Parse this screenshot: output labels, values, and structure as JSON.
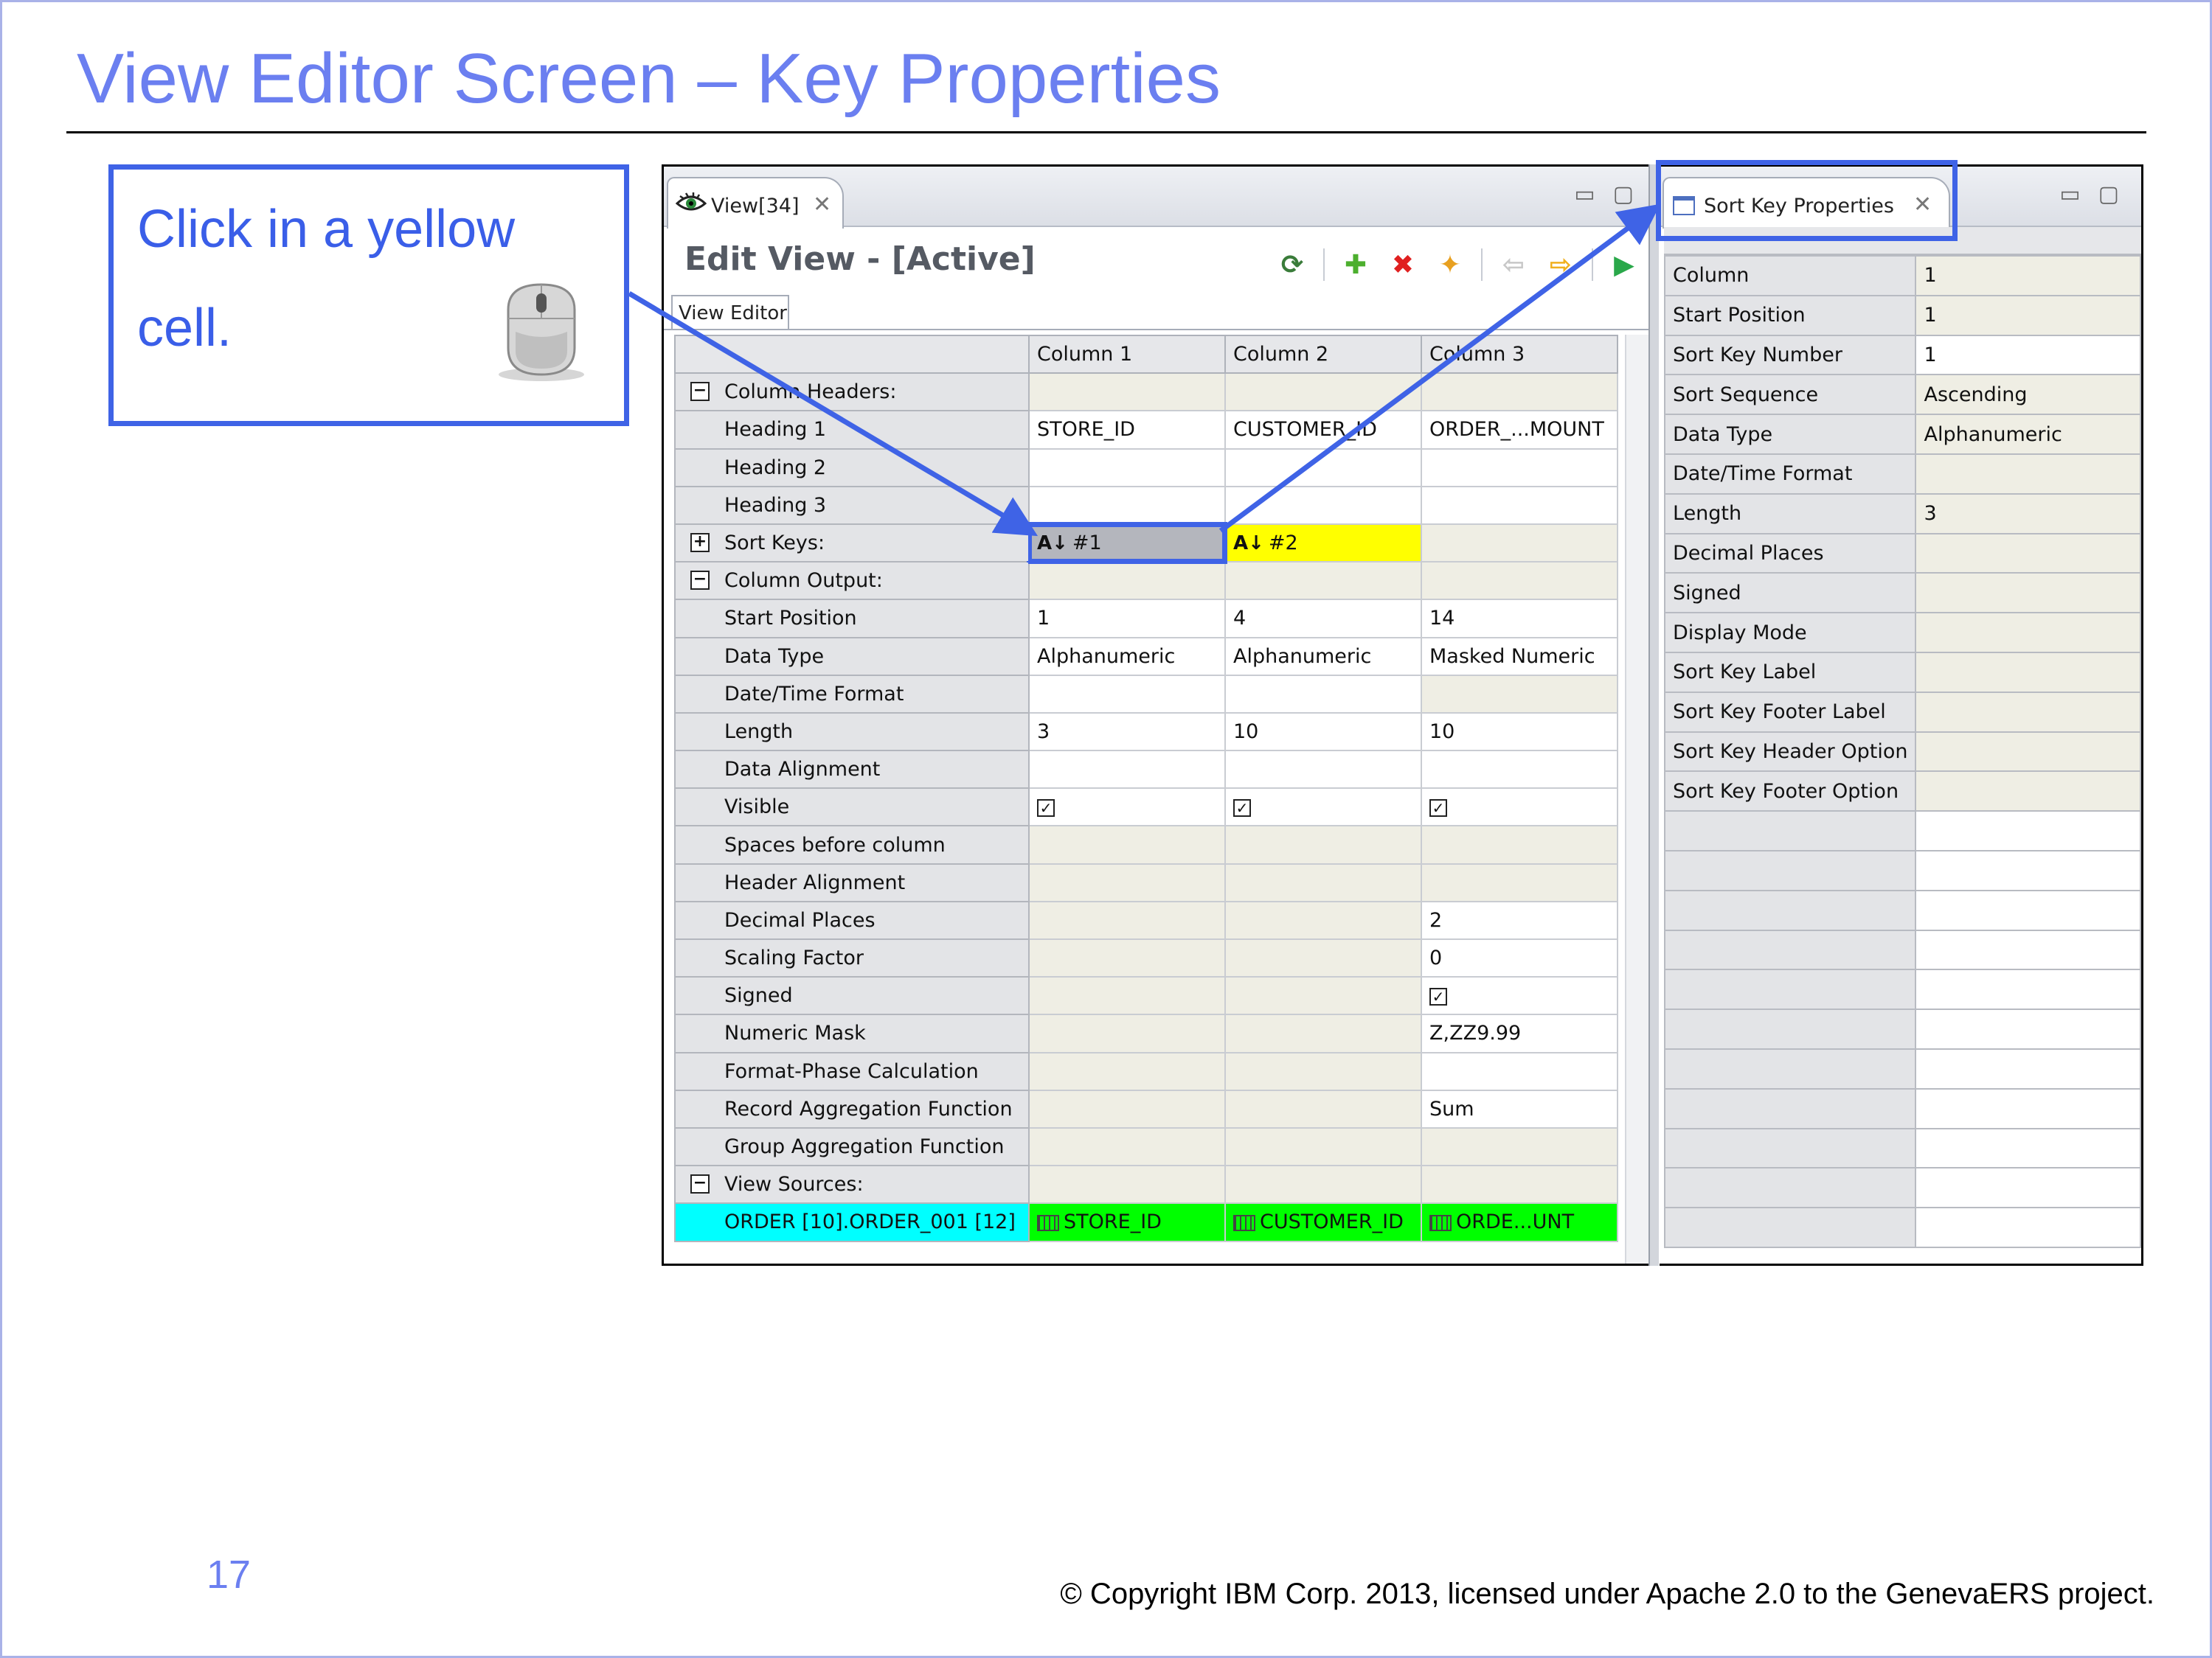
{
  "slide": {
    "title": "View Editor Screen – Key Properties",
    "callout_text": "Click in a yellow cell.",
    "slide_number": "17",
    "copyright": "© Copyright IBM Corp. 2013, licensed under Apache 2.0 to the GenevaERS project."
  },
  "editor": {
    "tab_label": "View[34]",
    "heading": "Edit View - [Active]",
    "subtab": "View Editor",
    "columns": [
      "Column 1",
      "Column 2",
      "Column 3"
    ],
    "rows": {
      "column_headers": "Column Headers:",
      "heading1": {
        "label": "Heading 1",
        "c1": "STORE_ID",
        "c2": "CUSTOMER_ID",
        "c3": "ORDER_...MOUNT"
      },
      "heading2": {
        "label": "Heading 2"
      },
      "heading3": {
        "label": "Heading 3"
      },
      "sort_keys": {
        "label": "Sort Keys:",
        "c1": "#1",
        "c2": "#2"
      },
      "column_output": "Column Output:",
      "start_position": {
        "label": "Start Position",
        "c1": "1",
        "c2": "4",
        "c3": "14"
      },
      "data_type": {
        "label": "Data Type",
        "c1": "Alphanumeric",
        "c2": "Alphanumeric",
        "c3": "Masked Numeric"
      },
      "datetime_format": {
        "label": "Date/Time Format"
      },
      "length": {
        "label": "Length",
        "c1": "3",
        "c2": "10",
        "c3": "10"
      },
      "data_alignment": {
        "label": "Data Alignment"
      },
      "visible": {
        "label": "Visible"
      },
      "spaces_before": {
        "label": "Spaces before column"
      },
      "header_alignment": {
        "label": "Header Alignment"
      },
      "decimal_places": {
        "label": "Decimal Places",
        "c3": "2"
      },
      "scaling_factor": {
        "label": "Scaling Factor",
        "c3": "0"
      },
      "signed": {
        "label": "Signed"
      },
      "numeric_mask": {
        "label": "Numeric Mask",
        "c3": "Z,ZZ9.99"
      },
      "format_phase": {
        "label": "Format-Phase Calculation"
      },
      "record_agg": {
        "label": "Record Aggregation Function",
        "c3": "Sum"
      },
      "group_agg": {
        "label": "Group Aggregation Function"
      },
      "view_sources": "View Sources:",
      "source": {
        "label": "ORDER [10].ORDER_001 [12]",
        "c1": "STORE_ID",
        "c2": "CUSTOMER_ID",
        "c3": "ORDE...UNT"
      }
    },
    "colors": {
      "yellow": "#ffff00",
      "green": "#00ff00",
      "cyan": "#00ffff",
      "tan": "#efeee4",
      "highlight": "#3f63e6"
    }
  },
  "props": {
    "tab_label": "Sort Key Properties",
    "items": [
      {
        "label": "Column",
        "value": "1"
      },
      {
        "label": "Start Position",
        "value": "1"
      },
      {
        "label": "Sort Key Number",
        "value": "1"
      },
      {
        "label": "Sort Sequence",
        "value": "Ascending"
      },
      {
        "label": "Data Type",
        "value": "Alphanumeric"
      },
      {
        "label": "Date/Time Format",
        "value": ""
      },
      {
        "label": "Length",
        "value": "3"
      },
      {
        "label": "Decimal Places",
        "value": ""
      },
      {
        "label": "Signed",
        "value": ""
      },
      {
        "label": "Display Mode",
        "value": ""
      },
      {
        "label": "Sort Key Label",
        "value": ""
      },
      {
        "label": "Sort Key Footer Label",
        "value": ""
      },
      {
        "label": "Sort Key Header Option",
        "value": ""
      },
      {
        "label": "Sort Key Footer Option",
        "value": ""
      }
    ]
  }
}
